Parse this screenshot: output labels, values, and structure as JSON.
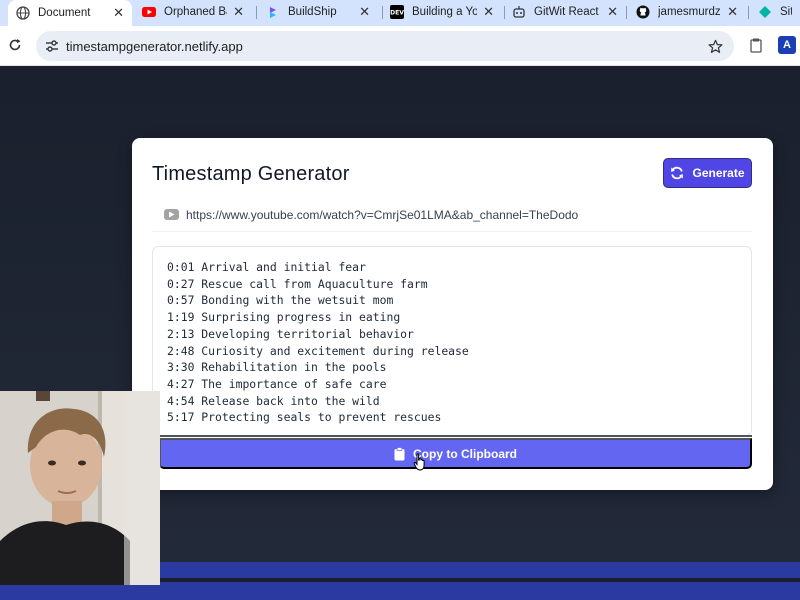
{
  "browser": {
    "tabs": [
      {
        "title": "Document",
        "icon": "globe-icon",
        "active": true
      },
      {
        "title": "Orphaned Ba",
        "icon": "youtube-icon",
        "active": false
      },
      {
        "title": "BuildShip",
        "icon": "buildship-icon",
        "active": false
      },
      {
        "title": "Building a Yo",
        "icon": "dev-icon",
        "active": false
      },
      {
        "title": "GitWit React",
        "icon": "robot-icon",
        "active": false
      },
      {
        "title": "jamesmurdza",
        "icon": "github-icon",
        "active": false
      },
      {
        "title": "Site",
        "icon": "diamond-icon",
        "active": false
      }
    ],
    "address": "timestampgenerator.netlify.app"
  },
  "app": {
    "title": "Timestamp Generator",
    "generate_label": "Generate",
    "video_url": "https://www.youtube.com/watch?v=CmrjSe01LMA&ab_channel=TheDodo",
    "timestamps": [
      {
        "time": "0:01",
        "label": "Arrival and initial fear"
      },
      {
        "time": "0:27",
        "label": "Rescue call from Aquaculture farm"
      },
      {
        "time": "0:57",
        "label": "Bonding with the wetsuit mom"
      },
      {
        "time": "1:19",
        "label": "Surprising progress in eating"
      },
      {
        "time": "2:13",
        "label": "Developing territorial behavior"
      },
      {
        "time": "2:48",
        "label": "Curiosity and excitement during release"
      },
      {
        "time": "3:30",
        "label": "Rehabilitation in the pools"
      },
      {
        "time": "4:27",
        "label": "The importance of safe care"
      },
      {
        "time": "4:54",
        "label": "Release back into the wild"
      },
      {
        "time": "5:17",
        "label": "Protecting seals to prevent rescues"
      }
    ],
    "copy_label": "Copy to Clipboard"
  },
  "colors": {
    "accent": "#4f46e5",
    "copy_button": "#6366f1",
    "page_bg": "#1a202c",
    "tab_strip": "#d3e3fd"
  }
}
